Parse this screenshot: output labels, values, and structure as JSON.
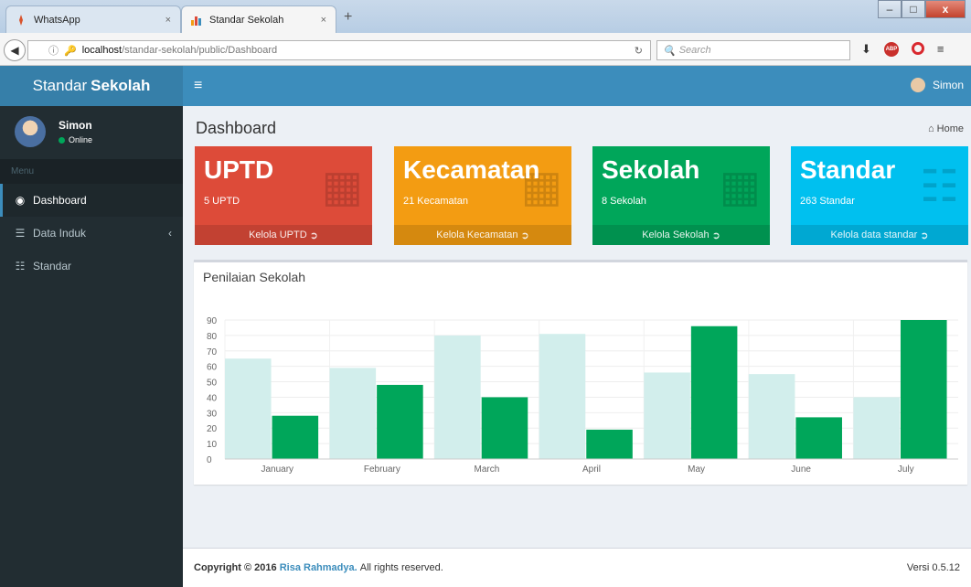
{
  "browser": {
    "tabs": [
      {
        "title": "WhatsApp",
        "close": "×"
      },
      {
        "title": "Standar Sekolah",
        "close": "×"
      }
    ],
    "new_tab": "+",
    "window": {
      "minimize": "–",
      "maximize": "□",
      "close": "x"
    },
    "url_prefix": "localhost",
    "url_path": "/standar-sekolah/public/Dashboard",
    "search_placeholder": "Search"
  },
  "app": {
    "logo_light": "Standar",
    "logo_bold": "Sekolah",
    "user_name": "Simon"
  },
  "sidebar": {
    "user": {
      "name": "Simon",
      "status": "Online"
    },
    "menu_header": "Menu",
    "items": [
      {
        "label": "Dashboard",
        "icon": "dashboard-icon"
      },
      {
        "label": "Data Induk",
        "icon": "database-icon"
      },
      {
        "label": "Standar",
        "icon": "sliders-icon"
      }
    ]
  },
  "page": {
    "title": "Dashboard",
    "breadcrumb": "Home"
  },
  "stats": [
    {
      "title": "UPTD",
      "subtitle": "5 UPTD",
      "link": "Kelola UPTD",
      "color": "#dd4b39"
    },
    {
      "title": "Kecamatan",
      "subtitle": "21 Kecamatan",
      "link": "Kelola Kecamatan",
      "color": "#f39c12"
    },
    {
      "title": "Sekolah",
      "subtitle": "8 Sekolah",
      "link": "Kelola Sekolah",
      "color": "#00a65a"
    },
    {
      "title": "Standar",
      "subtitle": "263 Standar",
      "link": "Kelola data standar",
      "color": "#00c0ef"
    }
  ],
  "chart_panel": {
    "title": "Penilaian Sekolah"
  },
  "chart_data": {
    "type": "bar",
    "categories": [
      "January",
      "February",
      "March",
      "April",
      "May",
      "June",
      "July"
    ],
    "series": [
      {
        "values": [
          65,
          59,
          80,
          81,
          56,
          55,
          40
        ],
        "color": "#d2eeec"
      },
      {
        "values": [
          28,
          48,
          40,
          19,
          86,
          27,
          90
        ],
        "color": "#00a65a"
      }
    ],
    "ylim": [
      0,
      90
    ],
    "yticks": [
      0,
      10,
      20,
      30,
      40,
      50,
      60,
      70,
      80,
      90
    ],
    "grid": true
  },
  "footer": {
    "copyright_prefix": "Copyright © 2016",
    "author": "Risa Rahmadya.",
    "suffix": "All rights reserved.",
    "version": "Versi 0.5.12"
  }
}
